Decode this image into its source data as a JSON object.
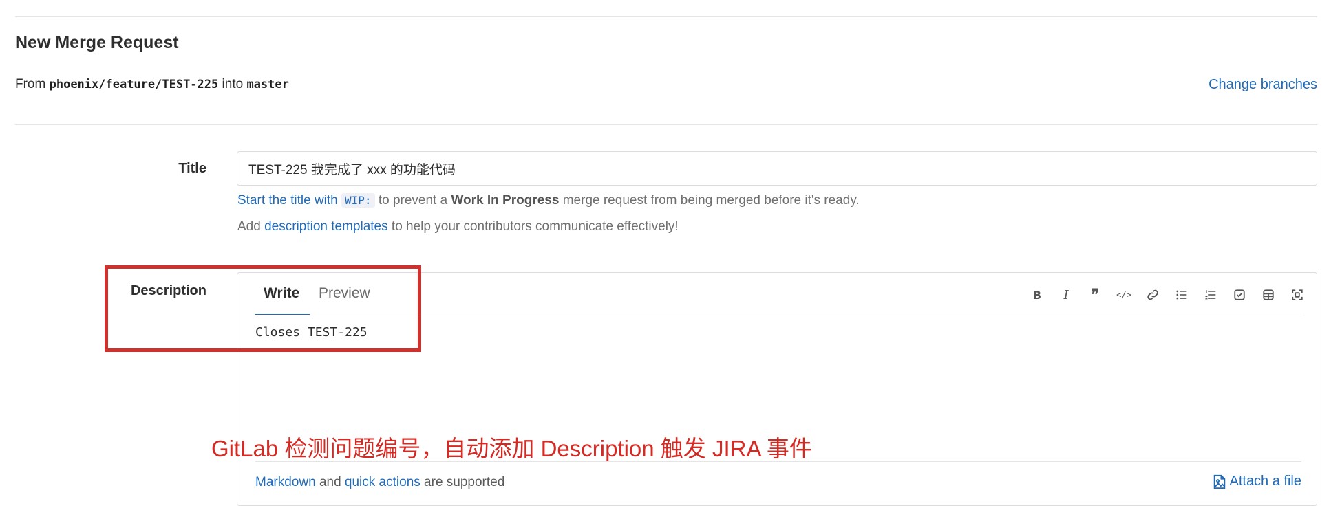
{
  "page": {
    "title": "New Merge Request"
  },
  "branches": {
    "from_label": "From",
    "source": "phoenix/feature/TEST-225",
    "into_label": "into",
    "target": "master",
    "change_link": "Change branches"
  },
  "form": {
    "title_label": "Title",
    "title_value": "TEST-225 我完成了 xxx 的功能代码",
    "wip_hint": {
      "link": "Start the title with",
      "code": "WIP:",
      "text_before_bold": "to prevent a",
      "bold": "Work In Progress",
      "text_after": "merge request from being merged before it's ready."
    },
    "template_hint": {
      "prefix": "Add",
      "link": "description templates",
      "suffix": "to help your contributors communicate effectively!"
    },
    "description_label": "Description",
    "tabs": {
      "write": "Write",
      "preview": "Preview"
    },
    "description_value": "Closes TEST-225",
    "toolbar": [
      "bold-icon",
      "italic-icon",
      "quote-icon",
      "code-icon",
      "link-icon",
      "bullet-list-icon",
      "numbered-list-icon",
      "task-list-icon",
      "table-icon",
      "fullscreen-icon"
    ],
    "footer": {
      "markdown_link": "Markdown",
      "and": "and",
      "quick_actions_link": "quick actions",
      "supported": "are supported",
      "attach": "Attach a file"
    }
  },
  "annotation": {
    "text": "GitLab 检测问题编号，自动添加 Description 触发 JIRA 事件",
    "color": "#d0312d"
  },
  "colors": {
    "link": "#1f6ab9",
    "border": "#dcdcdc"
  }
}
